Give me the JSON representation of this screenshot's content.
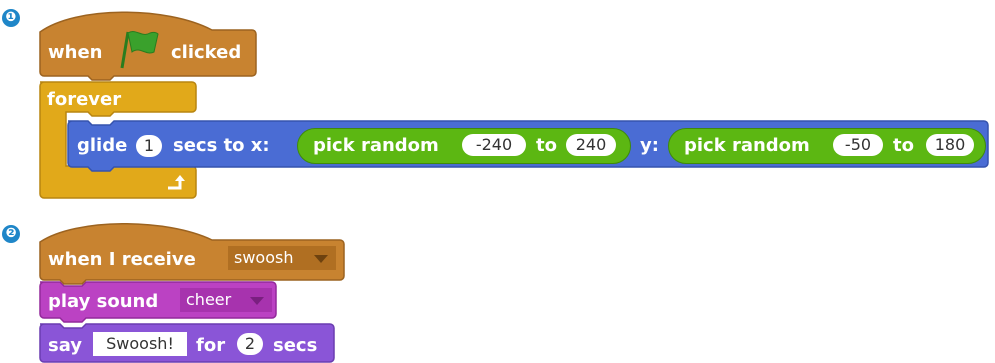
{
  "step_markers": [
    "❶",
    "❷"
  ],
  "script1": {
    "hat": {
      "when": "when",
      "clicked": "clicked",
      "flag_icon": "green-flag-icon"
    },
    "forever": {
      "label": "forever",
      "loop_icon": "loop-arrow-icon"
    },
    "glide": {
      "glide": "glide",
      "secs_value": "1",
      "secs_to_x": "secs to x:",
      "pick_random_1": "pick random",
      "x_from": "-240",
      "to_1": "to",
      "x_to": "240",
      "y_label": "y:",
      "pick_random_2": "pick random",
      "y_from": "-50",
      "to_2": "to",
      "y_to": "180"
    }
  },
  "script2": {
    "receive": {
      "label": "when I receive",
      "message": "swoosh"
    },
    "play_sound": {
      "label": "play sound",
      "sound": "cheer"
    },
    "say": {
      "label": "say",
      "text": "Swoosh!",
      "for": "for",
      "secs_value": "2",
      "secs": "secs"
    }
  },
  "colors": {
    "events": "#c88330",
    "control": "#e1a91a",
    "motion": "#4a6cd4",
    "operators": "#5cb712",
    "sound": "#bb42c3",
    "looks": "#8a55d7",
    "step_marker": "#1f86c8"
  }
}
